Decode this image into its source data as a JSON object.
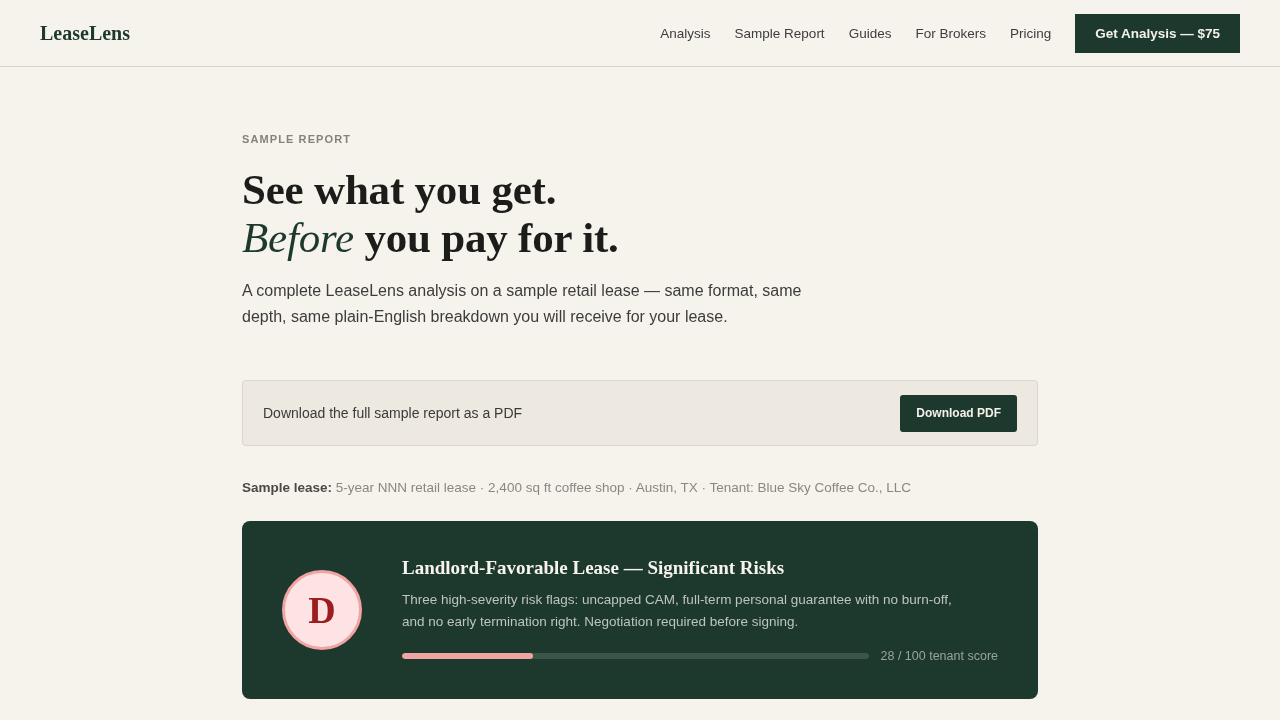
{
  "header": {
    "logo": "LeaseLens",
    "nav": [
      "Analysis",
      "Sample Report",
      "Guides",
      "For Brokers",
      "Pricing"
    ],
    "cta": "Get Analysis — $75"
  },
  "hero": {
    "eyebrow": "SAMPLE REPORT",
    "headline": [
      "See what you get.",
      "*Before* you pay for it."
    ],
    "intro": "A complete LeaseLens analysis on a sample retail lease — same format, same depth, same plain-English breakdown you will receive for your lease."
  },
  "download": {
    "text": "Download the full sample report as a PDF",
    "button": "Download PDF"
  },
  "sample_lease": "**Sample lease:** 5-year NNN retail lease · 2,400 sq ft coffee shop · Austin, TX · Tenant: Blue Sky Coffee Co., LLC",
  "score_card": {
    "grade": "D",
    "title": "Landlord-Favorable Lease — Significant Risks",
    "description": "Three high-severity risk flags: uncapped CAM, full-term personal guarantee with no burn-off, and no early termination right. Negotiation required before signing.",
    "level": 0.28,
    "reading": "28 / 100 tenant score"
  }
}
